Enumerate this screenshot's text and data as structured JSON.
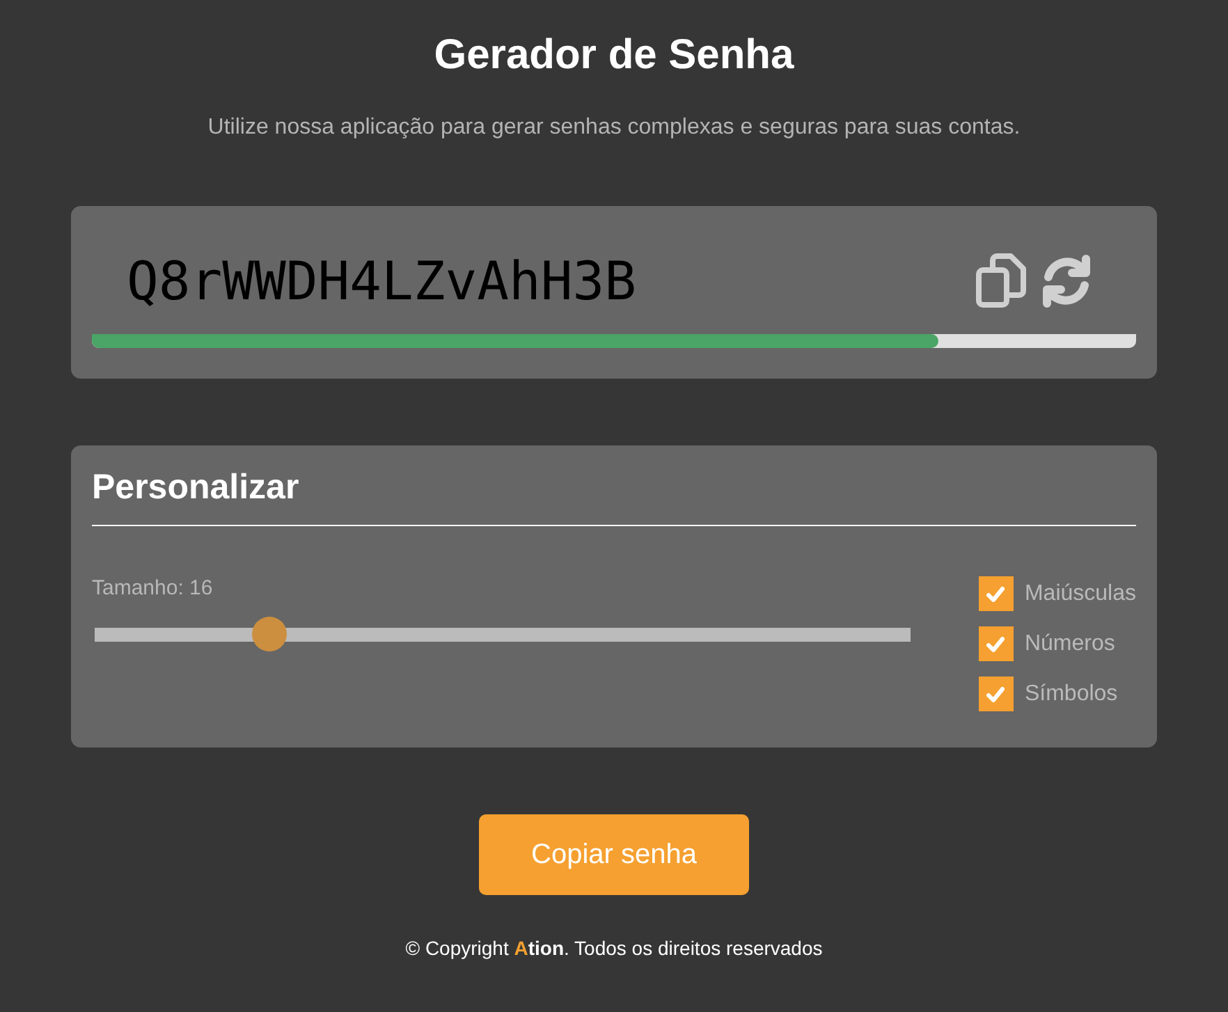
{
  "header": {
    "title": "Gerador de Senha",
    "subtitle": "Utilize nossa aplicação para gerar senhas complexas e seguras para suas contas."
  },
  "password": {
    "value": "Q8rWWDH4LZvAhH3B",
    "strength": {
      "level": 0.81
    }
  },
  "customize": {
    "title": "Personalizar",
    "length_label": "Tamanho: 16",
    "slider": {
      "level": 0.214
    },
    "options": [
      {
        "label": "Maiúsculas",
        "checked": true
      },
      {
        "label": "Números",
        "checked": true
      },
      {
        "label": "Símbolos",
        "checked": true
      }
    ]
  },
  "copy_button": "Copiar senha",
  "footer": {
    "before": "© Copyright",
    "brand_initial": "A",
    "brand_rest": "tion",
    "after": ". Todos os direitos reservados"
  }
}
